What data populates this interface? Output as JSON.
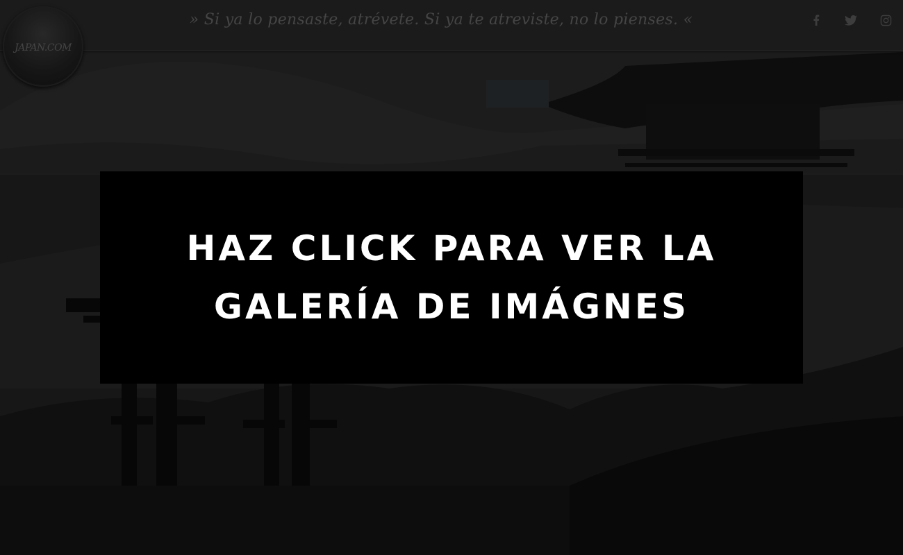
{
  "header": {
    "logo_text": "JAPAN.COM",
    "tagline": "» Si ya lo pensaste, atrévete. Si ya te atreviste, no lo pienses. «",
    "social": [
      {
        "name": "facebook-icon",
        "glyph": "f"
      },
      {
        "name": "twitter-icon",
        "glyph": "t"
      },
      {
        "name": "instagram-icon",
        "glyph": "i"
      }
    ]
  },
  "cta": {
    "label": "HAZ CLICK PARA VER LA GALERÍA DE IMÁGNES"
  },
  "colors": {
    "cta_background": "#000000",
    "cta_text": "#ffffff",
    "header_background": "#2a2a2a"
  }
}
